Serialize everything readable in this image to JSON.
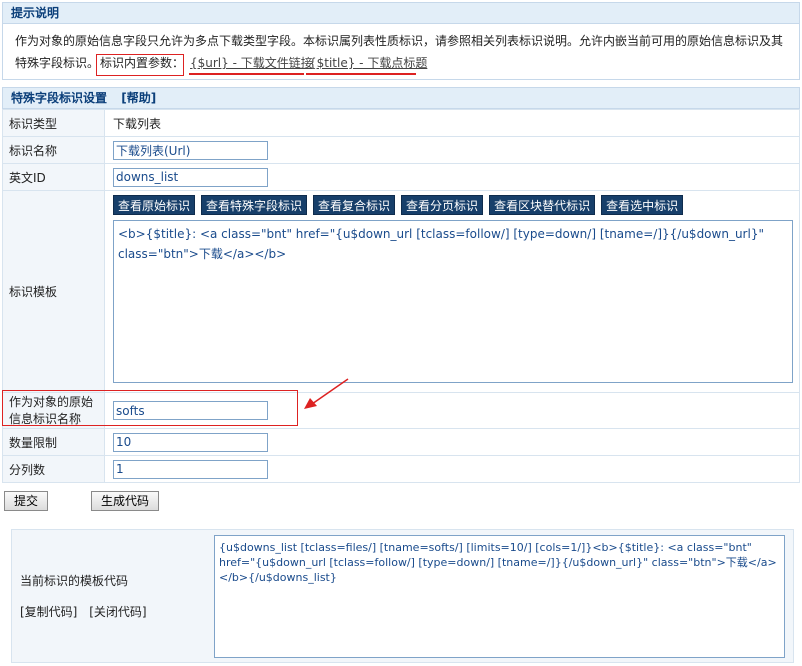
{
  "tip": {
    "heading": "提示说明",
    "line1": "作为对象的原始信息字段只允许为多点下载类型字段。本标识属列表性质标识，请参照相关列表标识说明。允许内嵌当前可用的原始信息标识及其",
    "line2_prefix": "特殊字段标识。",
    "params_label": "标识内置参数：",
    "param_url": "{$url} - 下载文件链接",
    "param_title": "{$title} - 下载点标题"
  },
  "form": {
    "heading": "特殊字段标识设置",
    "help_link": "[帮助]",
    "rows": {
      "type_label": "标识类型",
      "type_value": "下载列表",
      "name_label": "标识名称",
      "name_value": "下载列表(Url)",
      "enid_label": "英文ID",
      "enid_value": "downs_list",
      "template_label": "标识模板",
      "template_value": "<b>{$title}: <a class=\"bnt\" href=\"{u$down_url [tclass=follow/] [type=down/] [tname=/]}{/u$down_url}\" class=\"btn\">下载</a></b>",
      "source_label_1": "作为对象的原始",
      "source_label_2": "信息标识名称",
      "source_value": "softs",
      "limit_label": "数量限制",
      "limit_value": "10",
      "cols_label": "分列数",
      "cols_value": "1"
    },
    "view_buttons": [
      "查看原始标识",
      "查看特殊字段标识",
      "查看复合标识",
      "查看分页标识",
      "查看区块替代标识",
      "查看选中标识"
    ]
  },
  "actions": {
    "submit": "提交",
    "generate": "生成代码"
  },
  "code_section": {
    "title": "当前标识的模板代码",
    "copy_link": "[复制代码]",
    "close_link": "[关闭代码]",
    "code_text": "{u$downs_list [tclass=files/] [tname=softs/] [limits=10/] [cols=1/]}<b>{$title}: <a class=\"bnt\" href=\"{u$down_url [tclass=follow/] [type=down/] [tname=/]}{/u$down_url}\" class=\"btn\">下载</a></b>{/u$downs_list}"
  },
  "colors": {
    "annotation": "#dd2222",
    "dark_button": "#173f6a",
    "panel_head": "#e2eef8"
  }
}
